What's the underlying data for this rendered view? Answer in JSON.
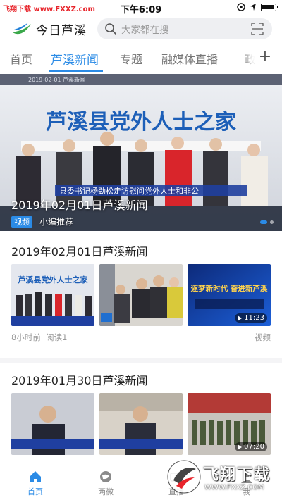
{
  "status_bar": {
    "watermark_top": "飞翔下载 www.FXXZ.com",
    "time": "下午6:09"
  },
  "header": {
    "app_name": "今日芦溪",
    "search_placeholder": "大家都在搜"
  },
  "tabs": [
    {
      "label": "首页"
    },
    {
      "label": "芦溪新闻"
    },
    {
      "label": "专题"
    },
    {
      "label": "融媒体直播"
    },
    {
      "label": "政"
    }
  ],
  "tab_add": "+",
  "hero": {
    "sign_text": "芦溪县党外人士之家",
    "banner_text": "县委书记杨劲松走访慰问党外人士和非公",
    "title": "2019年02月01日芦溪新闻",
    "tag": "视频",
    "subtitle": "小编推荐"
  },
  "news": [
    {
      "title": "2019年02月01日芦溪新闻",
      "thumbs": [
        {
          "caption": "芦溪县党外人士之家"
        },
        {
          "caption": ""
        },
        {
          "caption": "逐梦新时代 奋进新芦溪",
          "duration": "11:23"
        }
      ],
      "time_ago": "8小时前",
      "reads": "阅读1",
      "type": "视频"
    },
    {
      "title": "2019年01月30日芦溪新闻",
      "thumbs": [
        {
          "caption": ""
        },
        {
          "caption": ""
        },
        {
          "caption": "",
          "duration": "07:20"
        }
      ]
    }
  ],
  "bottom_nav": [
    {
      "label": "首页",
      "icon": "home-icon",
      "active": true
    },
    {
      "label": "两微",
      "icon": "planet-icon",
      "active": false
    },
    {
      "label": "直播",
      "icon": "live-icon",
      "active": false
    },
    {
      "label": "我",
      "icon": "user-icon",
      "active": false
    }
  ],
  "watermark": {
    "text": "飞翔下载",
    "url": "WWW.FXXZ.COM"
  },
  "colors": {
    "accent": "#2b8be6",
    "watermark_red": "#e8242b"
  }
}
